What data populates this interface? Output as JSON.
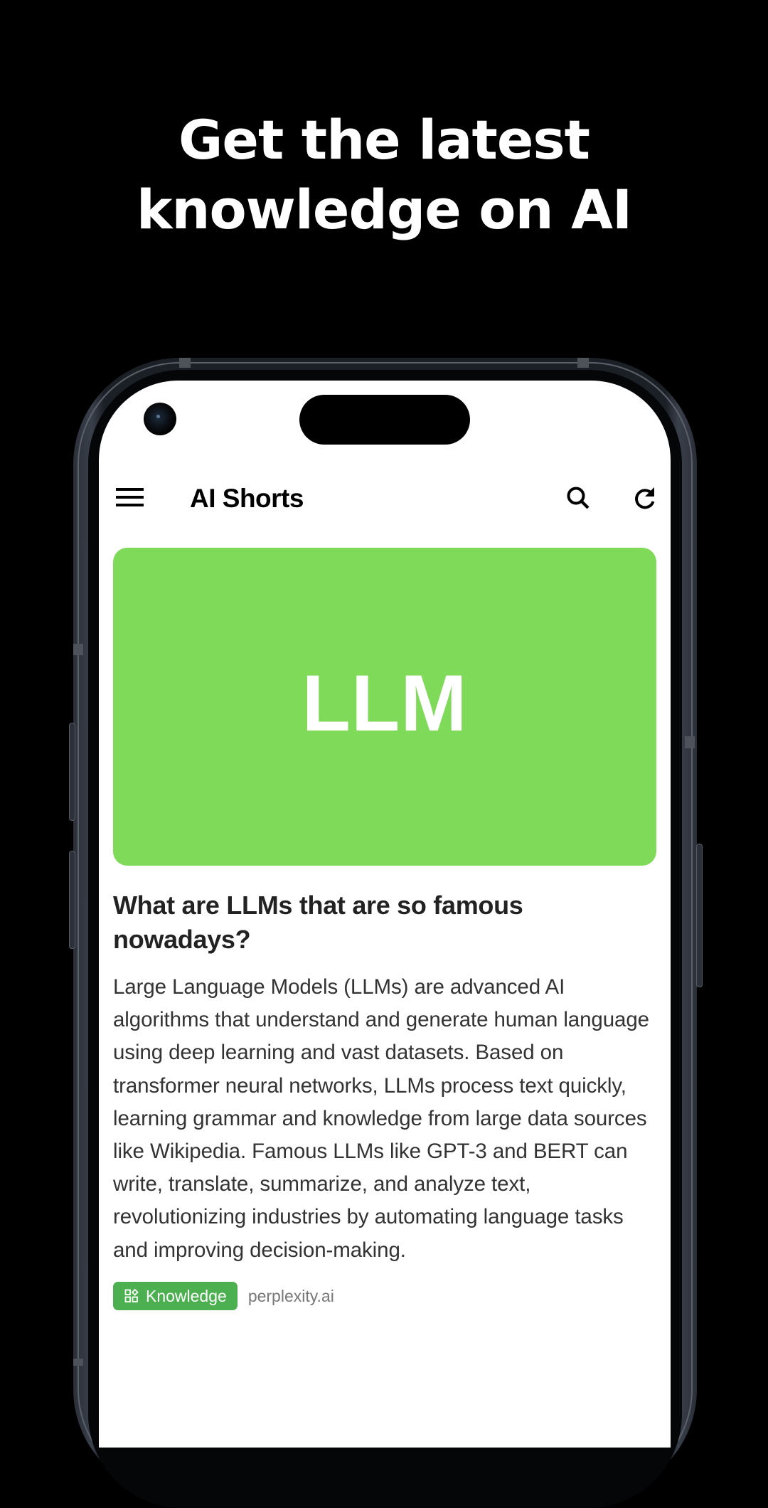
{
  "promo": {
    "headline_line1": "Get the latest",
    "headline_line2": "knowledge on AI"
  },
  "app": {
    "title": "AI Shorts",
    "icons": {
      "menu": "menu-icon",
      "search": "search-icon",
      "refresh": "refresh-icon"
    }
  },
  "article": {
    "hero_text": "LLM",
    "hero_color": "#80DA5A",
    "title": "What are LLMs that are so famous nowadays?",
    "body": "Large Language Models (LLMs) are advanced AI algorithms that understand and generate human language using deep learning and vast datasets. Based on transformer neural networks, LLMs process text quickly, learning grammar and knowledge from large data sources like Wikipedia. Famous LLMs like GPT-3 and BERT can write, translate, summarize, and analyze text, revolutionizing industries by automating language tasks and improving decision-making.",
    "category": {
      "label": "Knowledge",
      "icon": "category-icon",
      "color": "#4CAF50"
    },
    "source": "perplexity.ai"
  }
}
